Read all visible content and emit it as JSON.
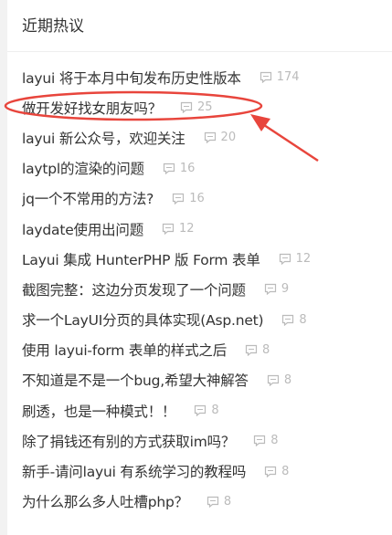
{
  "panel": {
    "title": "近期热议"
  },
  "hot_list": [
    {
      "title": "layui 将于本月中旬发布历史性版本",
      "comments": "174"
    },
    {
      "title": "做开发好找女朋友吗？",
      "comments": "25"
    },
    {
      "title": "layui 新公众号，欢迎关注",
      "comments": "20"
    },
    {
      "title": "laytpl的渲染的问题",
      "comments": "16"
    },
    {
      "title": "jq一个不常用的方法?",
      "comments": "16"
    },
    {
      "title": "laydate使用出问题",
      "comments": "12"
    },
    {
      "title": "Layui 集成 HunterPHP 版 Form 表单",
      "comments": "12"
    },
    {
      "title": "截图完整：这边分页发现了一个问题",
      "comments": "9"
    },
    {
      "title": "求一个LayUI分页的具体实现(Asp.net)",
      "comments": "8"
    },
    {
      "title": "使用 layui-form 表单的样式之后",
      "comments": "8"
    },
    {
      "title": "不知道是不是一个bug,希望大神解答",
      "comments": "8"
    },
    {
      "title": "刷透，也是一种模式！！",
      "comments": "8"
    },
    {
      "title": "除了捐钱还有别的方式获取im吗？",
      "comments": "8"
    },
    {
      "title": "新手-请问layui 有系统学习的教程吗",
      "comments": "8"
    },
    {
      "title": "为什么那么多人吐槽php？",
      "comments": "8"
    }
  ],
  "colors": {
    "annotation": "#e8453c",
    "meta": "#bbbbbb",
    "title": "#333333"
  },
  "icons": {
    "comment": "comment-icon"
  }
}
